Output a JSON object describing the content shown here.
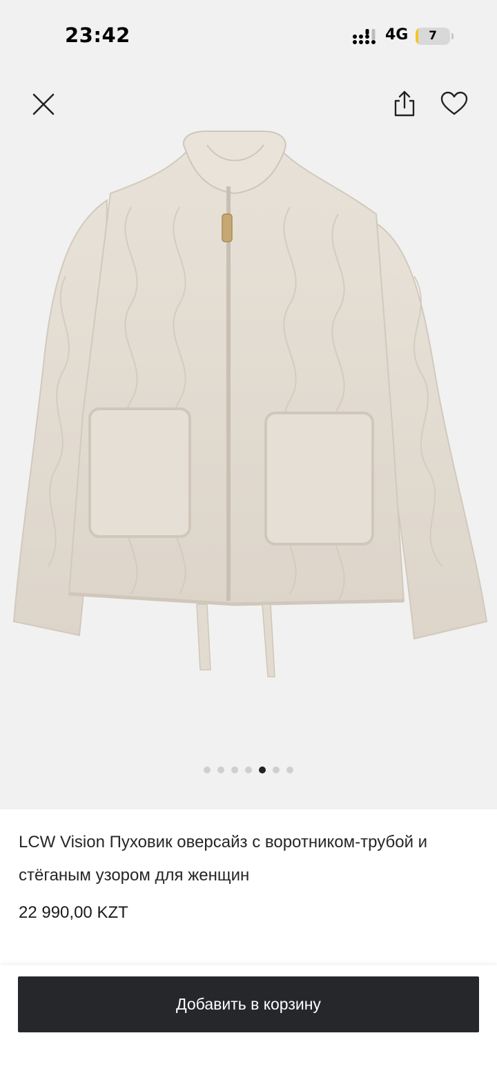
{
  "status_bar": {
    "time": "23:42",
    "network": "4G",
    "battery_level": "7",
    "battery_fraction": 0.07
  },
  "top_actions": {
    "close_icon": "close-icon",
    "share_icon": "share-icon",
    "favorite_icon": "heart-icon"
  },
  "gallery": {
    "total_images": 7,
    "active_index": 4
  },
  "product": {
    "title": "LCW Vision Пуховик оверсайз с воротником-трубой и стёганым узором для женщин",
    "price": "22 990,00 KZT"
  },
  "cart": {
    "button_label": "Добавить в корзину"
  },
  "colors": {
    "button_bg": "#25272b",
    "jacket": "#e4ddd3",
    "gallery_bg": "#f1f1f1",
    "battery": "#f5c623"
  }
}
